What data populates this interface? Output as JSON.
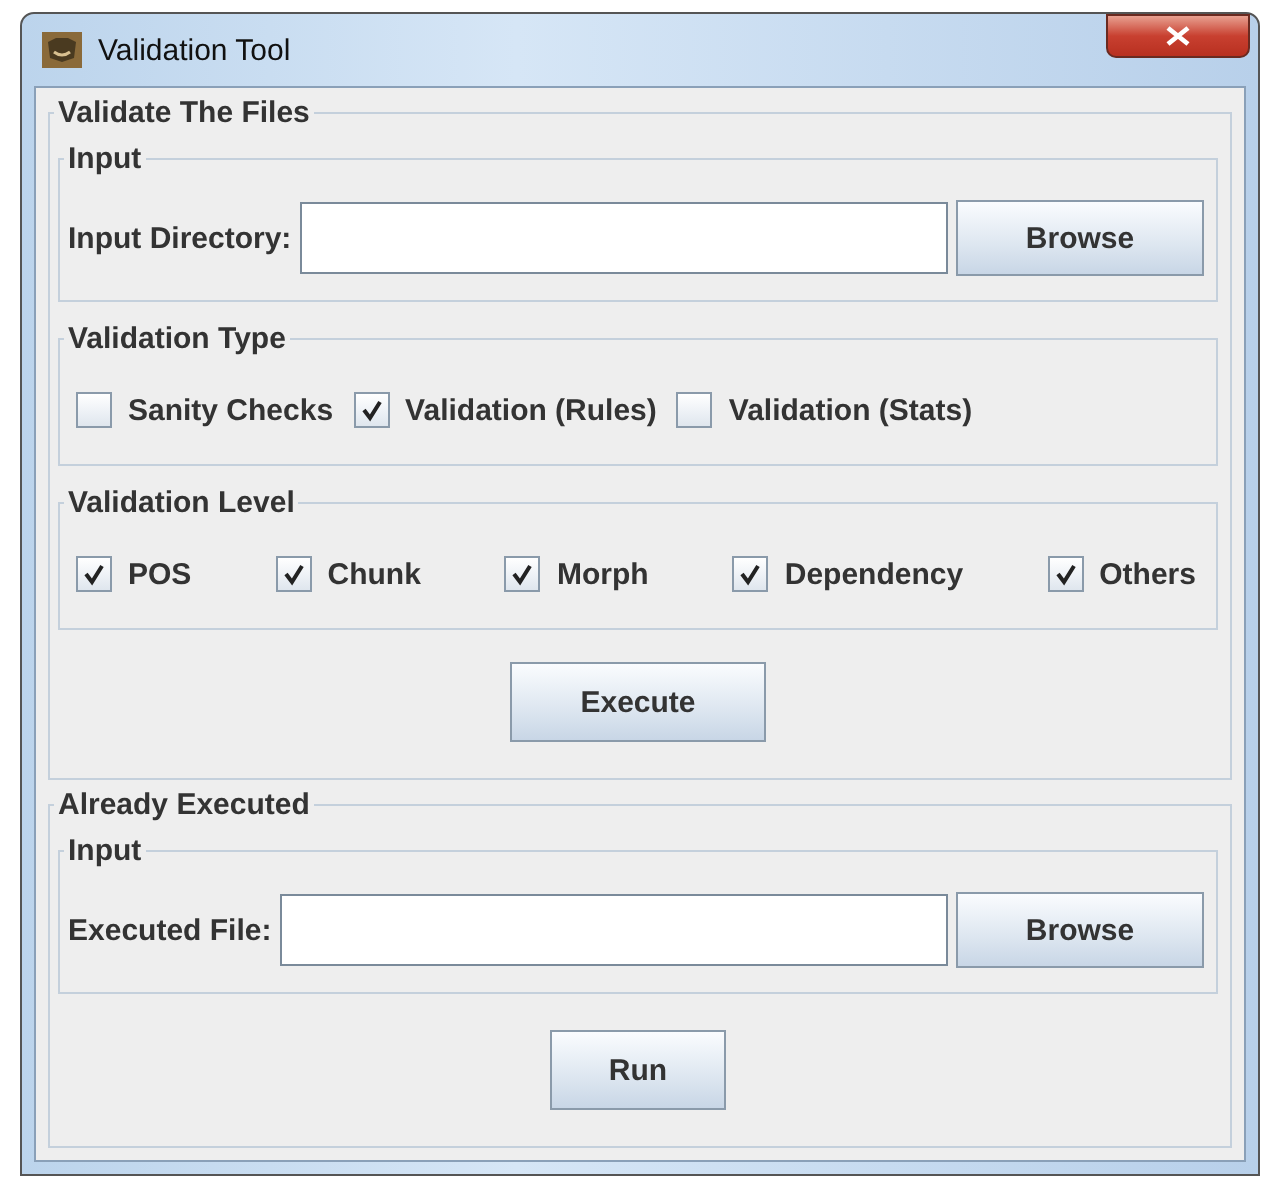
{
  "window": {
    "title": "Validation Tool"
  },
  "validate_group": {
    "title": "Validate The Files",
    "input_group": {
      "title": "Input",
      "label": "Input Directory:",
      "button": "Browse"
    },
    "type_group": {
      "title": "Validation Type",
      "options": [
        {
          "label": "Sanity Checks",
          "checked": false
        },
        {
          "label": "Validation (Rules)",
          "checked": true
        },
        {
          "label": "Validation (Stats)",
          "checked": false
        }
      ]
    },
    "level_group": {
      "title": "Validation Level",
      "options": [
        {
          "label": "POS",
          "checked": true
        },
        {
          "label": "Chunk",
          "checked": true
        },
        {
          "label": "Morph",
          "checked": true
        },
        {
          "label": "Dependency",
          "checked": true
        },
        {
          "label": "Others",
          "checked": true
        }
      ]
    },
    "button": "Execute"
  },
  "executed_group": {
    "title": "Already Executed",
    "input_group": {
      "title": "Input",
      "label": "Executed File:",
      "button": "Browse"
    },
    "button": "Run"
  }
}
